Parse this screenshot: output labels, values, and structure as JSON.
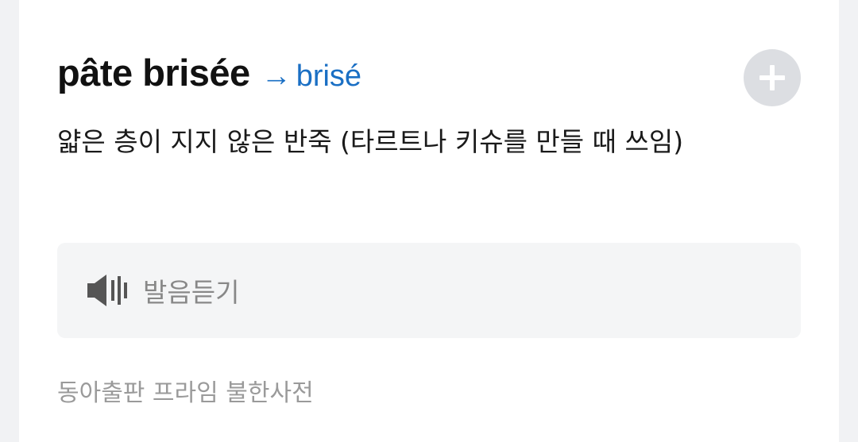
{
  "entry": {
    "headword": "pâte brisée",
    "ref_arrow": "→",
    "ref_word": "brisé",
    "definition": "얇은 층이 지지 않은 반죽 (타르트나 키슈를 만들 때 쓰임)"
  },
  "add_button": {
    "icon": "plus-icon"
  },
  "audio": {
    "icon": "speaker-icon",
    "label": "발음듣기"
  },
  "source": "동아출판 프라임 불한사전",
  "colors": {
    "link": "#1a6fc4",
    "add_button_bg": "#dcdee2",
    "audio_bg": "#f4f5f6",
    "muted_text": "#888888"
  }
}
